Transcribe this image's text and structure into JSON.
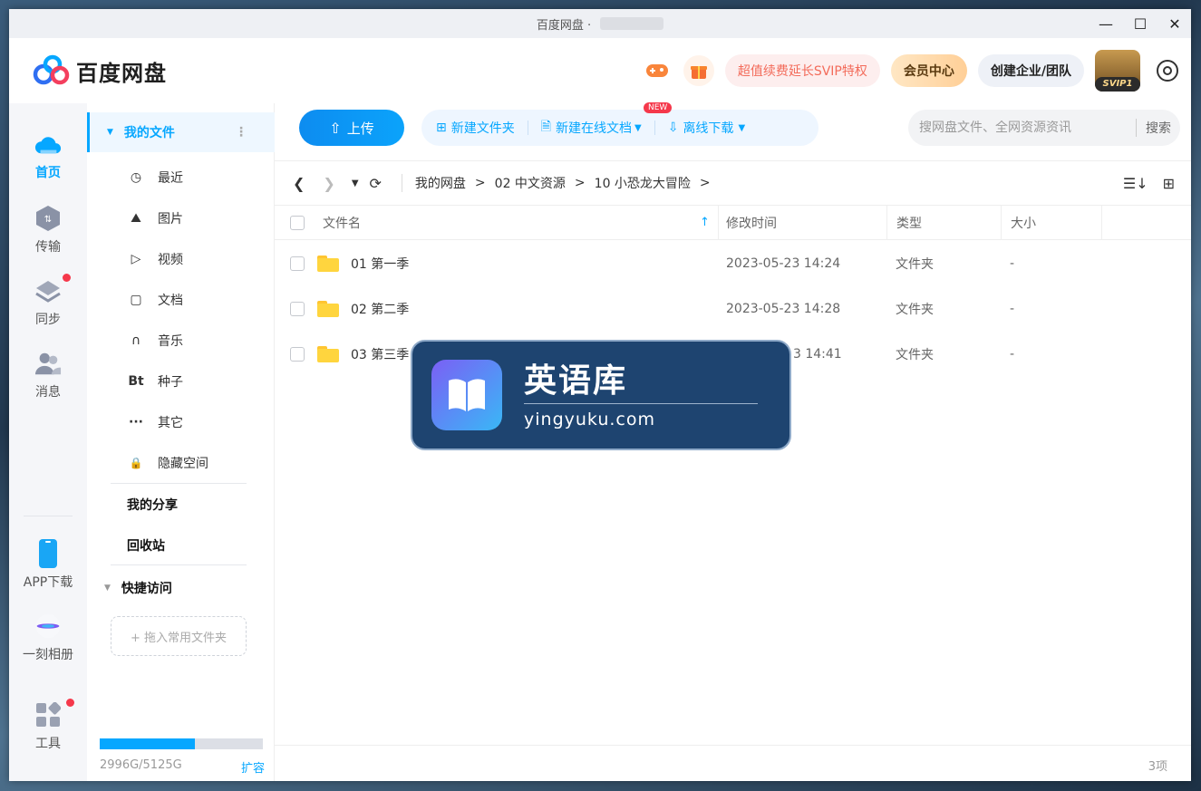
{
  "window": {
    "title": "百度网盘 ·",
    "controls": {
      "minimize": "—",
      "maximize": "☐",
      "close": "✕"
    }
  },
  "header": {
    "logo_text": "百度网盘",
    "game_icon": "gamepad-icon",
    "gift_icon": "gift-icon",
    "svip_promo": "超值续费延长SVIP特权",
    "member_center": "会员中心",
    "create_enterprise": "创建企业/团队",
    "avatar_badge": "SVIP1",
    "settings_icon": "settings-icon"
  },
  "rail": {
    "items": [
      {
        "label": "首页",
        "icon": "cloud-icon"
      },
      {
        "label": "传输",
        "icon": "transfer-icon"
      },
      {
        "label": "同步",
        "icon": "sync-icon"
      },
      {
        "label": "消息",
        "icon": "message-icon"
      },
      {
        "label": "APP下载",
        "icon": "phone-icon"
      },
      {
        "label": "一刻相册",
        "icon": "album-icon"
      },
      {
        "label": "工具",
        "icon": "tools-icon"
      }
    ]
  },
  "sidebar": {
    "my_files": "我的文件",
    "items": [
      {
        "label": "最近",
        "icon": "◷"
      },
      {
        "label": "图片",
        "icon": "⛰"
      },
      {
        "label": "视频",
        "icon": "▷"
      },
      {
        "label": "文档",
        "icon": "▢"
      },
      {
        "label": "音乐",
        "icon": "∩"
      },
      {
        "label": "种子",
        "icon": "Bt"
      },
      {
        "label": "其它",
        "icon": "···"
      },
      {
        "label": "隐藏空间",
        "icon": "🔒"
      }
    ],
    "my_share": "我的分享",
    "recycle_bin": "回收站",
    "quick_access": "快捷访问",
    "quick_drop": "+ 拖入常用文件夹",
    "storage_text": "2996G/5125G",
    "storage_used_fraction": 0.585,
    "expand": "扩容"
  },
  "toolbar": {
    "upload": "上传",
    "new_folder": "新建文件夹",
    "new_online_doc": "新建在线文档",
    "new_badge": "NEW",
    "offline_download": "离线下载",
    "search_placeholder": "搜网盘文件、全网资源资讯",
    "search_button": "搜索"
  },
  "breadcrumb": [
    "我的网盘",
    "02 中文资源",
    "10 小恐龙大冒险"
  ],
  "table": {
    "headers": {
      "name": "文件名",
      "time": "修改时间",
      "type": "类型",
      "size": "大小"
    },
    "rows": [
      {
        "name": "01 第一季",
        "time": "2023-05-23 14:24",
        "type": "文件夹",
        "size": "-"
      },
      {
        "name": "02 第二季",
        "time": "2023-05-23 14:28",
        "type": "文件夹",
        "size": "-"
      },
      {
        "name": "03 第三季",
        "time": "3 14:41",
        "type": "文件夹",
        "size": "-"
      }
    ]
  },
  "footer": {
    "count": "3项"
  },
  "watermark": {
    "title": "英语库",
    "url": "yingyuku.com"
  },
  "colors": {
    "accent": "#06a7ff",
    "alert": "#f5384b",
    "folder": "#ffd53e"
  }
}
